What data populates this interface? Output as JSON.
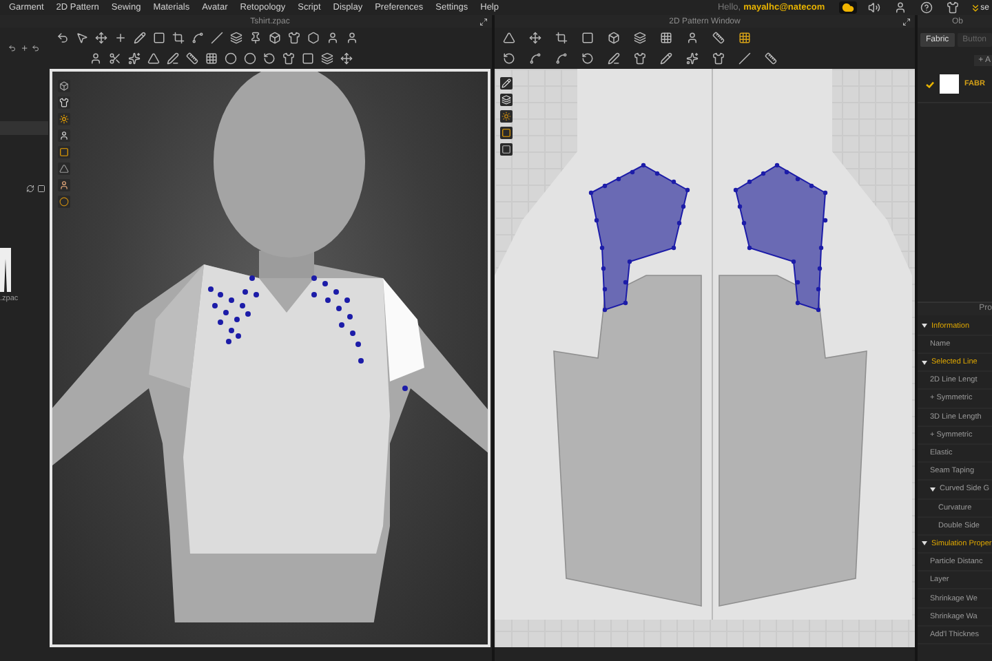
{
  "menu_bar": {
    "items": [
      "Garment",
      "2D Pattern",
      "Sewing",
      "Materials",
      "Avatar",
      "Retopology",
      "Script",
      "Display",
      "Preferences",
      "Settings",
      "Help"
    ],
    "greeting": "Hello,",
    "user": "mayalhc@natecom",
    "extra": "se"
  },
  "left_panel": {
    "file_label": ".zpac"
  },
  "viewport_3d": {
    "title": "Tshirt.zpac",
    "selected": true
  },
  "pattern_window": {
    "title": "2D Pattern Window"
  },
  "object_browser": {
    "title": "Ob",
    "tabs": [
      {
        "label": "Fabric",
        "selected": true
      },
      {
        "label": "Button",
        "selected": false
      }
    ],
    "add_label": "+ A",
    "fabrics": [
      {
        "name": "FABR",
        "checked": true
      }
    ]
  },
  "property_editor": {
    "title": "Pro",
    "groups": [
      {
        "label": "Information",
        "expanded": true,
        "children": [
          {
            "label": "Name"
          }
        ]
      },
      {
        "label": "Selected Line",
        "expanded": true,
        "children": [
          {
            "label": "2D Line Lengt"
          },
          {
            "label": "+ Symmetric"
          },
          {
            "label": "3D Line Length"
          },
          {
            "label": "+ Symmetric"
          },
          {
            "label": "Elastic"
          },
          {
            "label": "Seam Taping"
          },
          {
            "label": "Curved Side G",
            "expanded": true,
            "children": [
              {
                "label": "Curvature"
              },
              {
                "label": "Double Side"
              }
            ]
          }
        ]
      },
      {
        "label": "Simulation Proper",
        "expanded": true,
        "children": [
          {
            "label": "Particle Distanc"
          },
          {
            "label": "Layer"
          },
          {
            "label": "Shrinkage We"
          },
          {
            "label": "Shrinkage Wa"
          },
          {
            "label": "Add'l Thicknes"
          }
        ]
      }
    ]
  }
}
